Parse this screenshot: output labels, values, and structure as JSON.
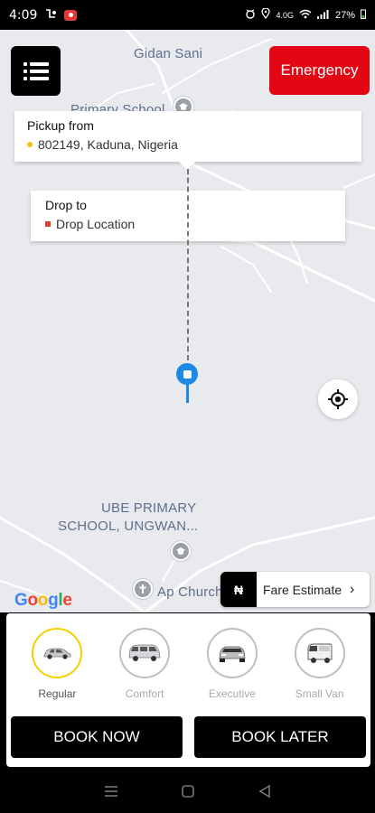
{
  "status_bar": {
    "time": "4:09",
    "battery": "27%",
    "network": "4.0G"
  },
  "map": {
    "labels": {
      "gidan_sani": "Gidan Sani",
      "primary_school": "Primary School",
      "ube_line1": "UBE PRIMARY",
      "ube_line2": "SCHOOL, UNGWAN...",
      "ap_church": "Ap Church"
    },
    "google_logo_letters": [
      "G",
      "o",
      "o",
      "g",
      "l",
      "e"
    ]
  },
  "header": {
    "menu_icon": "list-menu-icon",
    "emergency_label": "Emergency",
    "emergency_color": "#e30613"
  },
  "pickup": {
    "title": "Pickup from",
    "value": "802149, Kaduna, Nigeria",
    "marker_color": "#f4c20d"
  },
  "drop": {
    "title": "Drop to",
    "value": "Drop Location",
    "marker_color": "#e53935"
  },
  "fare_estimate": {
    "currency_symbol": "₦",
    "label": "Fare Estimate",
    "chevron": "›"
  },
  "vehicles": [
    {
      "name": "Regular",
      "selected": true,
      "icon": "sedan-car-icon"
    },
    {
      "name": "Comfort",
      "selected": false,
      "icon": "minivan-icon"
    },
    {
      "name": "Executive",
      "selected": false,
      "icon": "suv-icon"
    },
    {
      "name": "Small Van",
      "selected": false,
      "icon": "van-icon"
    }
  ],
  "actions": {
    "book_now": "BOOK NOW",
    "book_later": "BOOK LATER"
  },
  "accent_color": "#1e88e5"
}
